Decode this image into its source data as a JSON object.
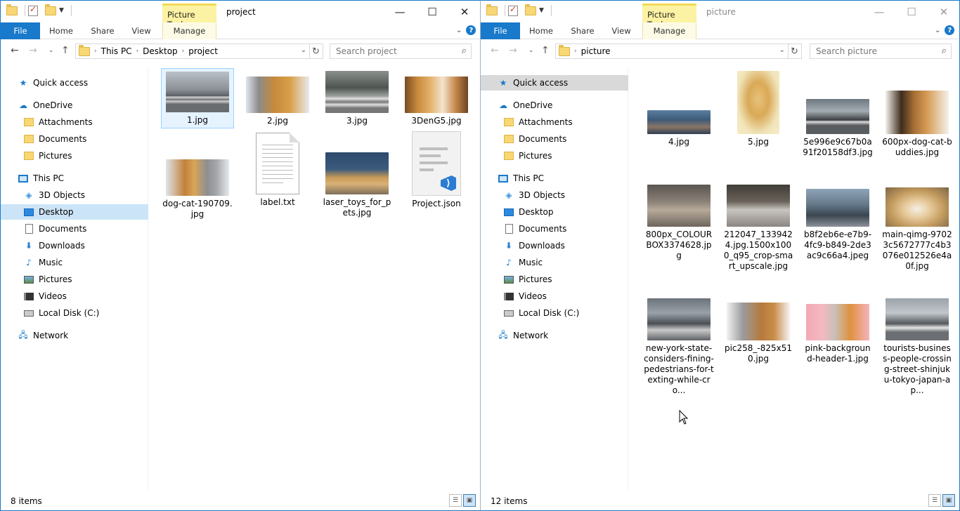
{
  "left": {
    "context_tab": "Picture Tools",
    "title": "project",
    "tabs": {
      "file": "File",
      "home": "Home",
      "share": "Share",
      "view": "View",
      "manage": "Manage"
    },
    "address": [
      "This PC",
      "Desktop",
      "project"
    ],
    "search_placeholder": "Search project",
    "status": "8 items",
    "files": [
      {
        "name": "1.jpg",
        "icon": "photo-street-crossing"
      },
      {
        "name": "2.jpg",
        "icon": "photo-cat-and-dog"
      },
      {
        "name": "3.jpg",
        "icon": "photo-street-crossing"
      },
      {
        "name": "3DenG5.jpg",
        "icon": "photo-puppy-and-kitten"
      },
      {
        "name": "dog-cat-190709.jpg",
        "icon": "photo-dog-and-cat"
      },
      {
        "name": "label.txt",
        "icon": "text-file-icon"
      },
      {
        "name": "laser_toys_for_pets.jpg",
        "icon": "photo-dog-and-cat"
      },
      {
        "name": "Project.json",
        "icon": "json-file-icon"
      }
    ]
  },
  "right": {
    "context_tab": "Picture Tools",
    "title": "picture",
    "tabs": {
      "file": "File",
      "home": "Home",
      "share": "Share",
      "view": "View",
      "manage": "Manage"
    },
    "address": [
      "picture"
    ],
    "search_placeholder": "Search picture",
    "status": "12 items",
    "files": [
      {
        "name": "4.jpg",
        "icon": "photo-lake"
      },
      {
        "name": "5.jpg",
        "icon": "photo-puppy"
      },
      {
        "name": "5e996e9c67b0a91f20158df3.jpg",
        "icon": "photo-street-crossing"
      },
      {
        "name": "600px-dog-cat-buddies.jpg",
        "icon": "photo-dog-and-cat"
      },
      {
        "name": "800px_COLOURBOX3374628.jpg",
        "icon": "photo-crowd"
      },
      {
        "name": "212047_1339424.jpg.1500x1000_q95_crop-smart_upscale.jpg",
        "icon": "photo-crowd"
      },
      {
        "name": "b8f2eb6e-e7b9-4fc9-b849-2de3ac9c66a4.jpeg",
        "icon": "photo-crowd"
      },
      {
        "name": "main-qimg-97023c5672777c4b3076e012526e4a0f.jpg",
        "icon": "photo-puppy"
      },
      {
        "name": "new-york-state-considers-fining-pedestrians-for-texting-while-cro...",
        "icon": "photo-crowd"
      },
      {
        "name": "pic258_-825x510.jpg",
        "icon": "photo-dog-and-cat"
      },
      {
        "name": "pink-background-header-1.jpg",
        "icon": "photo-pets-pink"
      },
      {
        "name": "tourists-business-people-crossing-street-shinjuku-tokyo-japan-ap...",
        "icon": "photo-street-crossing"
      }
    ]
  },
  "nav": {
    "quick_access": "Quick access",
    "onedrive": "OneDrive",
    "attachments": "Attachments",
    "documents_od": "Documents",
    "pictures_od": "Pictures",
    "this_pc": "This PC",
    "objects3d": "3D Objects",
    "desktop": "Desktop",
    "documents": "Documents",
    "downloads": "Downloads",
    "music": "Music",
    "pictures": "Pictures",
    "videos": "Videos",
    "local_disk": "Local Disk (C:)",
    "network": "Network"
  }
}
